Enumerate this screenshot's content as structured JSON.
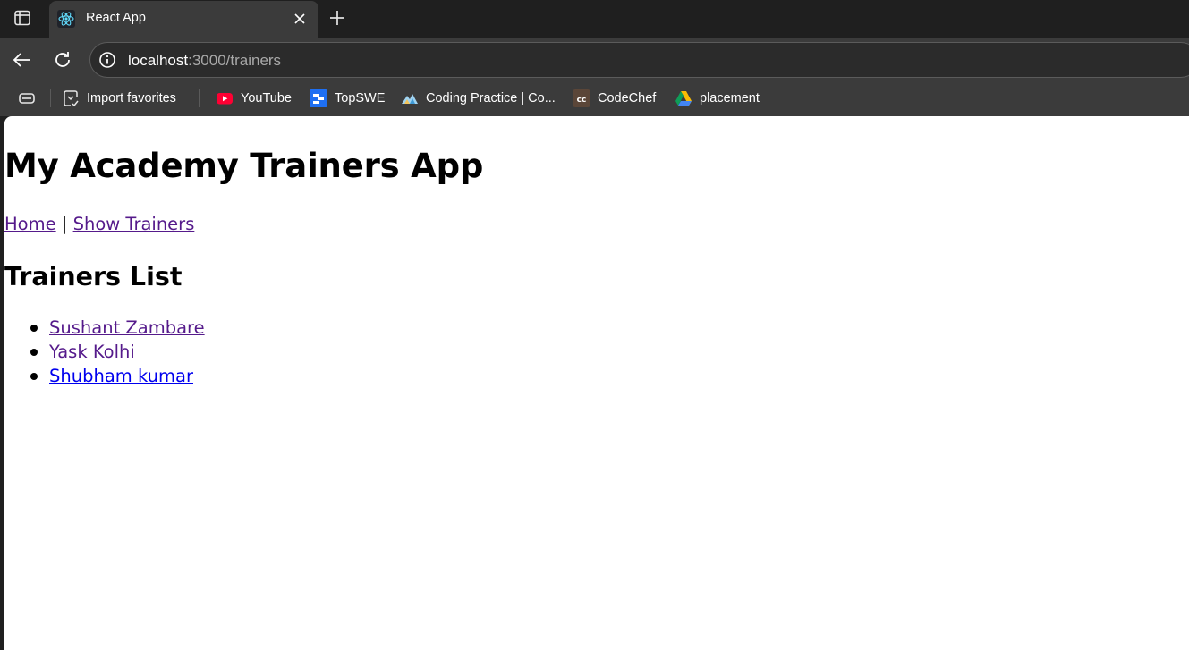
{
  "browser": {
    "tab": {
      "title": "React App",
      "favicon": "react-logo-icon"
    },
    "address_bar": {
      "host": "localhost",
      "path": ":3000/trainers"
    },
    "bookmarks": [
      {
        "label": "Import favorites",
        "icon": "import-favorites-icon"
      },
      {
        "label": "YouTube",
        "icon": "youtube-icon"
      },
      {
        "label": "TopSWE",
        "icon": "topswe-icon"
      },
      {
        "label": "Coding Practice | Co...",
        "icon": "coding-practice-icon"
      },
      {
        "label": "CodeChef",
        "icon": "codechef-icon"
      },
      {
        "label": "placement",
        "icon": "google-drive-icon"
      }
    ]
  },
  "page": {
    "title": "My Academy Trainers App",
    "nav": {
      "home": "Home",
      "separator": "|",
      "show_trainers": "Show Trainers"
    },
    "section_title": "Trainers List",
    "trainers": [
      {
        "name": "Sushant Zambare",
        "visited": true
      },
      {
        "name": "Yask Kolhi",
        "visited": true
      },
      {
        "name": "Shubham kumar",
        "visited": false
      }
    ]
  },
  "colors": {
    "link_visited": "#551a8b",
    "link_unvisited": "#0000ee",
    "chrome_dark": "#1f1f1f",
    "chrome_toolbar": "#3b3b3b"
  }
}
